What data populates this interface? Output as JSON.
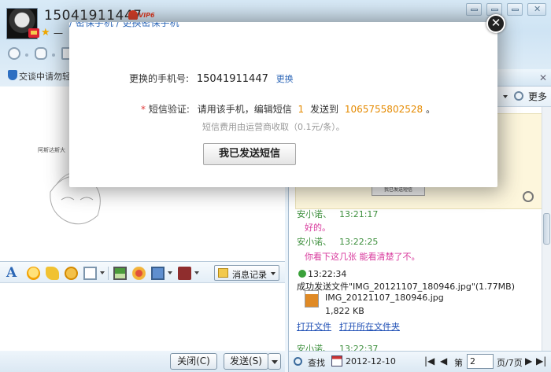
{
  "chat": {
    "contact_name": "15041911447",
    "vip_label": "VIP6",
    "signature": "一",
    "notice": "交谈中请勿轻",
    "sketch_caption": "阿斯达斯大"
  },
  "toolbar": {
    "message_log_label": "消息记录"
  },
  "buttons": {
    "close_label": "关闭(C)",
    "send_label": "发送(S)"
  },
  "history_panel": {
    "more_label": "更多",
    "inner_image_button": "我已发送短信",
    "messages": [
      {
        "sender": "安小诺、",
        "time": "13:21:17",
        "text": "好的。"
      },
      {
        "sender": "安小诺、",
        "time": "13:22:25",
        "text": "你看下这几张 能看清楚了不。"
      }
    ],
    "self_time": "13:22:34",
    "file_sent_text": "成功发送文件\"IMG_20121107_180946.jpg\"(1.77MB)",
    "file_name": "IMG_20121107_180946.jpg",
    "file_size": "1,822 KB",
    "open_file": "打开文件",
    "open_folder": "打开所在文件夹",
    "partial_sender": "安小诺、",
    "partial_time": "13:22:37",
    "search_label": "查找",
    "date": "2012-12-10",
    "page_prefix": "第",
    "page_value": "2",
    "page_suffix": "页/7页"
  },
  "modal": {
    "breadcrumb": "/ 密保手机 / 更换密保手机",
    "phone_label": "更换的手机号:",
    "phone_value": "15041911447",
    "change_link": "更换",
    "required_mark": "*",
    "sms_label": "短信验证:",
    "sms_instruction_a": "请用该手机，编辑短信",
    "sms_code": "1",
    "sms_instruction_b": "发送到",
    "sms_number": "1065755802528",
    "sms_end": "。",
    "fee_note": "短信费用由运营商收取（0.1元/条）。",
    "send_button": "我已发送短信",
    "close_symbol": "✕"
  },
  "colors": {
    "accent_orange": "#e58a00",
    "link_blue": "#2f68b8",
    "history_green": "#3d8f3d",
    "history_pink": "#d83a9d"
  }
}
